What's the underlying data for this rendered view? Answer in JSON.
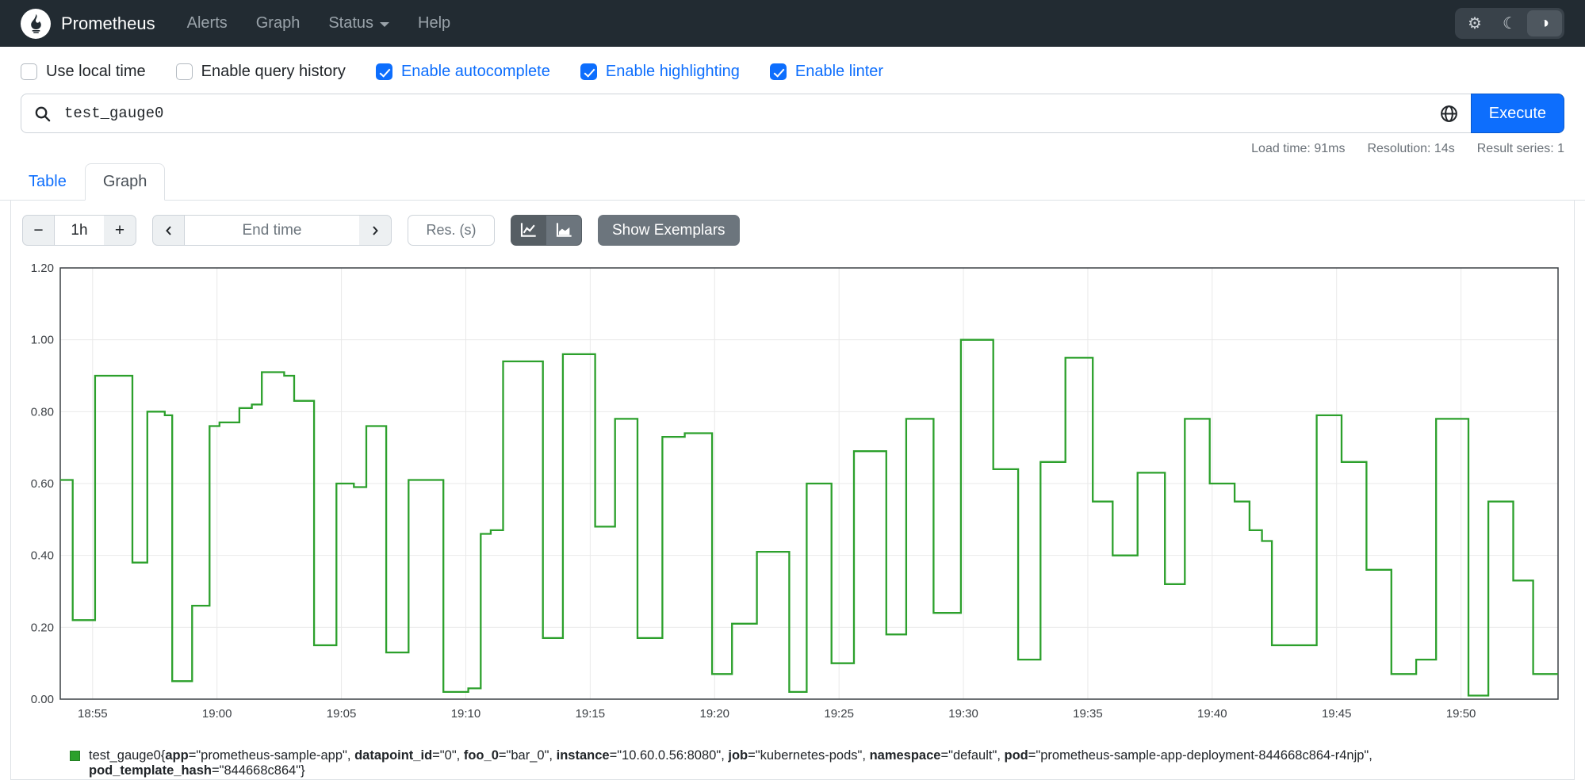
{
  "navbar": {
    "brand": "Prometheus",
    "items": [
      {
        "label": "Alerts"
      },
      {
        "label": "Graph"
      },
      {
        "label": "Status",
        "has_dropdown": true
      },
      {
        "label": "Help"
      }
    ],
    "theme_buttons": [
      {
        "name": "settings-gear-icon",
        "glyph": "⚙",
        "active": false
      },
      {
        "name": "dark-theme-moon-icon",
        "glyph": "☾",
        "active": false
      },
      {
        "name": "auto-theme-contrast-icon",
        "glyph": "◑",
        "active": true
      }
    ],
    "colors": {
      "background": "#222b32",
      "link": "#9aa3aa"
    }
  },
  "options": {
    "checkboxes": [
      {
        "label": "Use local time",
        "checked": false
      },
      {
        "label": "Enable query history",
        "checked": false
      },
      {
        "label": "Enable autocomplete",
        "checked": true
      },
      {
        "label": "Enable highlighting",
        "checked": true
      },
      {
        "label": "Enable linter",
        "checked": true
      }
    ],
    "checked_color": "#0d6efd"
  },
  "query": {
    "value": "test_gauge0",
    "execute_label": "Execute",
    "icons": [
      "search-icon",
      "metrics-explorer-globe-icon"
    ],
    "execute_color": "#0d6efd"
  },
  "stats": {
    "load_time": "Load time: 91ms",
    "resolution": "Resolution: 14s",
    "result_series": "Result series: 1"
  },
  "tabs": [
    {
      "label": "Table",
      "active": false
    },
    {
      "label": "Graph",
      "active": true
    }
  ],
  "graph_controls": {
    "minus_label": "−",
    "plus_label": "+",
    "range_value": "1h",
    "end_time_placeholder": "End time",
    "res_placeholder": "Res. (s)",
    "show_exemplars_label": "Show Exemplars",
    "chart_type_icons": [
      "line-chart-icon",
      "stacked-chart-icon"
    ]
  },
  "chart_data": {
    "type": "line",
    "subtype": "step-after",
    "title": "",
    "series_name": "test_gauge0",
    "series_color": "#2ca02c",
    "ylim": [
      0,
      1.2
    ],
    "yticks": [
      "0.00",
      "0.20",
      "0.40",
      "0.60",
      "0.80",
      "1.00",
      "1.20"
    ],
    "xticks": [
      {
        "label": "18:55",
        "t": 1.3
      },
      {
        "label": "19:00",
        "t": 6.3
      },
      {
        "label": "19:05",
        "t": 11.3
      },
      {
        "label": "19:10",
        "t": 16.3
      },
      {
        "label": "19:15",
        "t": 21.3
      },
      {
        "label": "19:20",
        "t": 26.3
      },
      {
        "label": "19:25",
        "t": 31.3
      },
      {
        "label": "19:30",
        "t": 36.3
      },
      {
        "label": "19:35",
        "t": 41.3
      },
      {
        "label": "19:40",
        "t": 46.3
      },
      {
        "label": "19:45",
        "t": 51.3
      },
      {
        "label": "19:50",
        "t": 56.3
      }
    ],
    "t_range": [
      0,
      60.2
    ],
    "grid": true,
    "points": [
      [
        0,
        0.61
      ],
      [
        0.5,
        0.22
      ],
      [
        1.4,
        0.9
      ],
      [
        2.9,
        0.38
      ],
      [
        3.5,
        0.8
      ],
      [
        4.2,
        0.79
      ],
      [
        4.5,
        0.05
      ],
      [
        5.3,
        0.26
      ],
      [
        6.0,
        0.76
      ],
      [
        6.4,
        0.77
      ],
      [
        7.2,
        0.81
      ],
      [
        7.7,
        0.82
      ],
      [
        8.1,
        0.91
      ],
      [
        9.0,
        0.9
      ],
      [
        9.4,
        0.83
      ],
      [
        10.2,
        0.15
      ],
      [
        11.1,
        0.6
      ],
      [
        11.8,
        0.59
      ],
      [
        12.3,
        0.76
      ],
      [
        13.1,
        0.13
      ],
      [
        14.0,
        0.61
      ],
      [
        14.8,
        0.61
      ],
      [
        15.4,
        0.02
      ],
      [
        16.4,
        0.03
      ],
      [
        16.9,
        0.46
      ],
      [
        17.3,
        0.47
      ],
      [
        17.8,
        0.94
      ],
      [
        19.4,
        0.17
      ],
      [
        20.2,
        0.96
      ],
      [
        21.0,
        0.96
      ],
      [
        21.5,
        0.48
      ],
      [
        22.3,
        0.78
      ],
      [
        23.2,
        0.17
      ],
      [
        24.2,
        0.73
      ],
      [
        25.1,
        0.74
      ],
      [
        26.2,
        0.07
      ],
      [
        27.0,
        0.21
      ],
      [
        28.0,
        0.41
      ],
      [
        29.3,
        0.02
      ],
      [
        30.0,
        0.6
      ],
      [
        31.0,
        0.1
      ],
      [
        31.9,
        0.69
      ],
      [
        33.2,
        0.18
      ],
      [
        34.0,
        0.78
      ],
      [
        35.1,
        0.24
      ],
      [
        36.2,
        1.0
      ],
      [
        37.5,
        0.64
      ],
      [
        38.5,
        0.11
      ],
      [
        39.4,
        0.66
      ],
      [
        40.4,
        0.95
      ],
      [
        41.5,
        0.55
      ],
      [
        42.3,
        0.4
      ],
      [
        43.3,
        0.63
      ],
      [
        44.4,
        0.32
      ],
      [
        45.2,
        0.78
      ],
      [
        46.2,
        0.6
      ],
      [
        47.2,
        0.55
      ],
      [
        47.8,
        0.47
      ],
      [
        48.3,
        0.44
      ],
      [
        48.7,
        0.15
      ],
      [
        50.5,
        0.79
      ],
      [
        51.5,
        0.66
      ],
      [
        52.5,
        0.36
      ],
      [
        53.5,
        0.07
      ],
      [
        54.5,
        0.11
      ],
      [
        55.3,
        0.78
      ],
      [
        56.6,
        0.01
      ],
      [
        57.4,
        0.55
      ],
      [
        58.4,
        0.33
      ],
      [
        59.2,
        0.07
      ],
      [
        60.1,
        0.07
      ]
    ]
  },
  "legend": {
    "metric": "test_gauge0",
    "labels": [
      [
        "app",
        "prometheus-sample-app"
      ],
      [
        "datapoint_id",
        "0"
      ],
      [
        "foo_0",
        "bar_0"
      ],
      [
        "instance",
        "10.60.0.56:8080"
      ],
      [
        "job",
        "kubernetes-pods"
      ],
      [
        "namespace",
        "default"
      ],
      [
        "pod",
        "prometheus-sample-app-deployment-844668c864-r4njp"
      ],
      [
        "pod_template_hash",
        "844668c864"
      ]
    ],
    "color": "#2ca02c"
  }
}
